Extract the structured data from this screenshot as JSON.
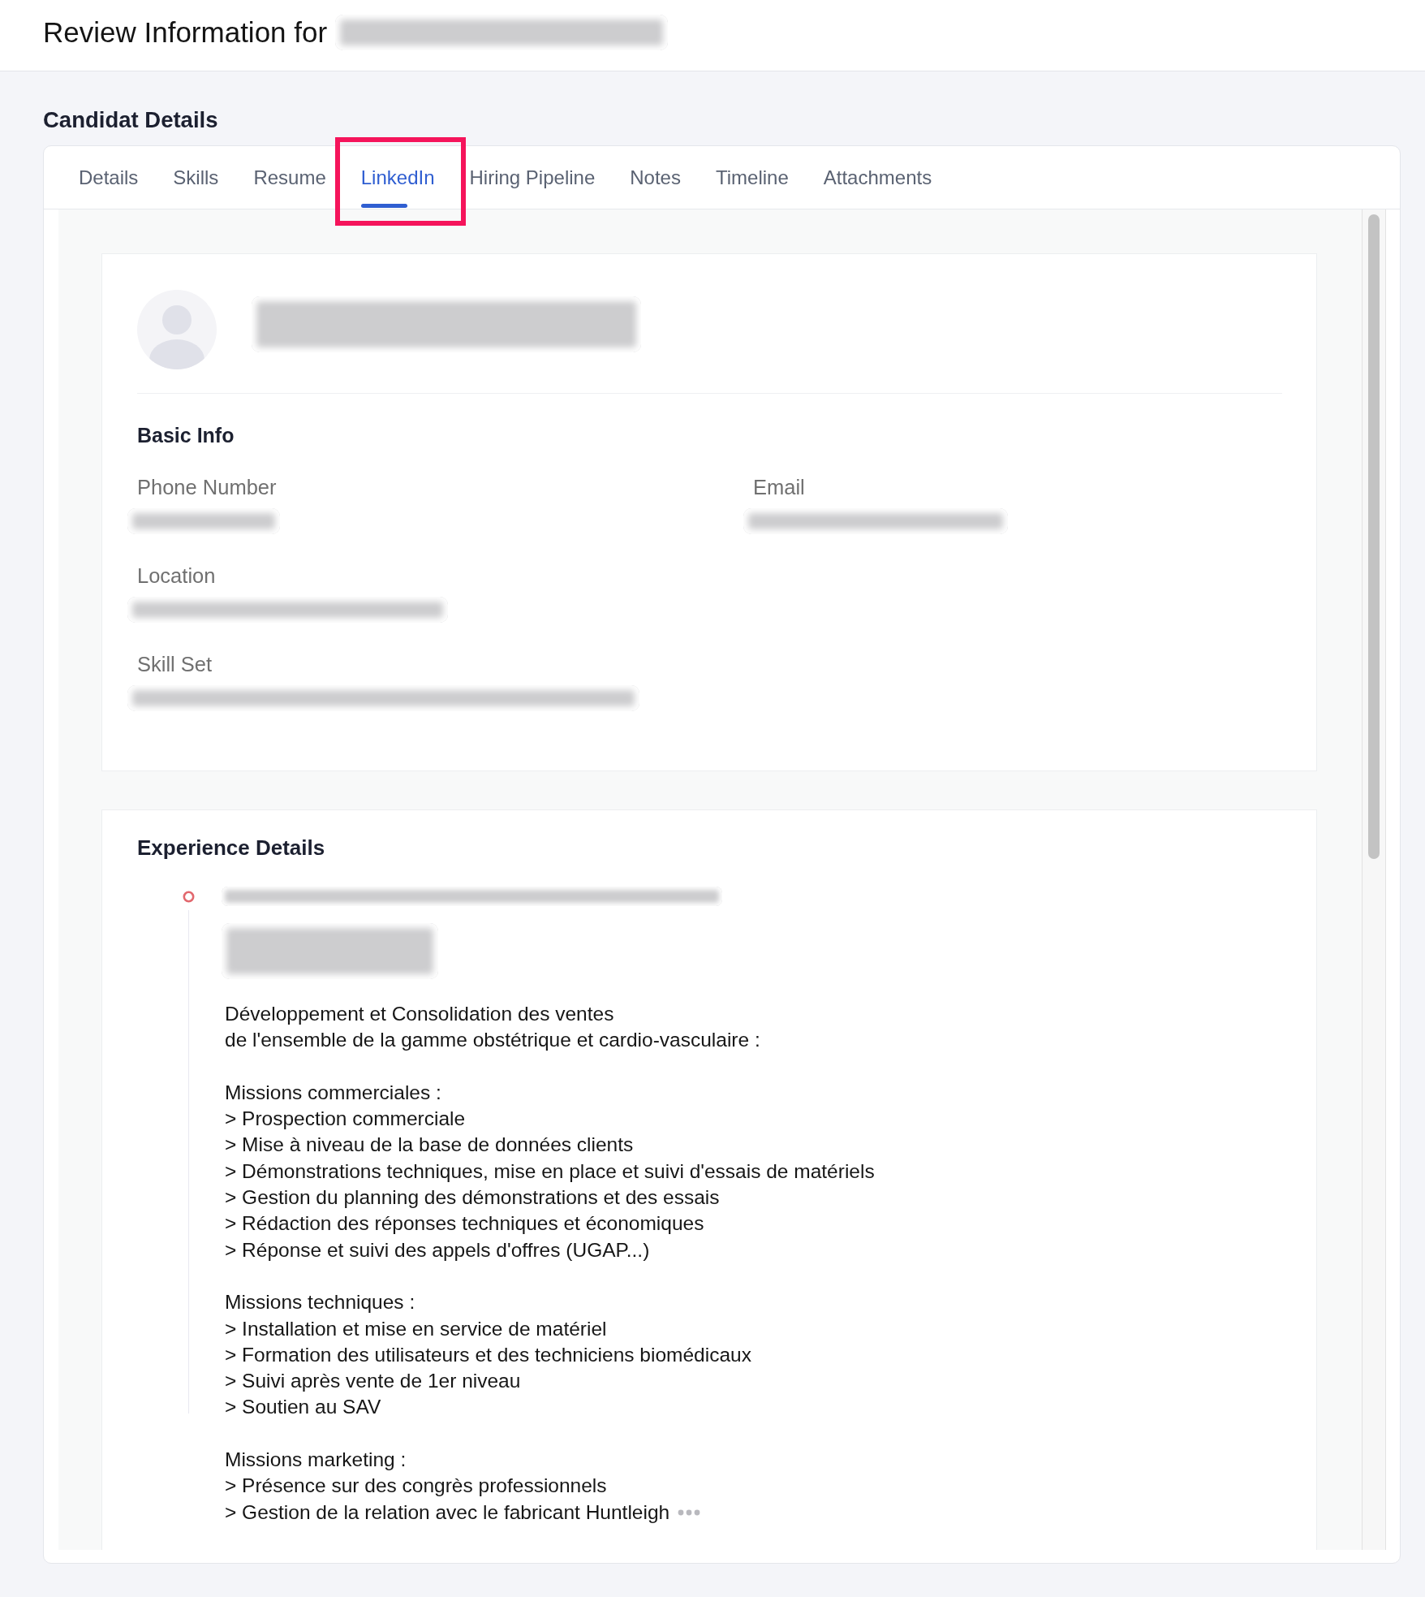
{
  "header": {
    "title": "Review Information for",
    "name_redacted": true
  },
  "page_title": "Candidat Details",
  "tabs": [
    {
      "label": "Details",
      "selected": false,
      "highlighted": false
    },
    {
      "label": "Skills",
      "selected": false,
      "highlighted": false
    },
    {
      "label": "Resume",
      "selected": false,
      "highlighted": false
    },
    {
      "label": "LinkedIn",
      "selected": true,
      "highlighted": true
    },
    {
      "label": "Hiring Pipeline",
      "selected": false,
      "highlighted": false
    },
    {
      "label": "Notes",
      "selected": false,
      "highlighted": false
    },
    {
      "label": "Timeline",
      "selected": false,
      "highlighted": false
    },
    {
      "label": "Attachments",
      "selected": false,
      "highlighted": false
    }
  ],
  "profile": {
    "name_redacted": true
  },
  "basic_info": {
    "title": "Basic Info",
    "fields": [
      {
        "label": "Phone Number",
        "redacted": true
      },
      {
        "label": "Email",
        "redacted": true
      },
      {
        "label": "Location",
        "redacted": true
      },
      {
        "label": "Skill Set",
        "redacted": true
      }
    ]
  },
  "experience": {
    "title": "Experience Details",
    "entries": [
      {
        "title_redacted": true,
        "company_redacted": true,
        "truncated": true,
        "description": [
          {
            "kind": "text",
            "lines": [
              "Développement et Consolidation des ventes",
              "de l'ensemble de la gamme obstétrique et cardio-vasculaire :"
            ]
          },
          {
            "kind": "list",
            "heading": "Missions commerciales :",
            "items": [
              "> Prospection commerciale",
              "> Mise à niveau de la base de données clients",
              "> Démonstrations techniques, mise en place et suivi d'essais de matériels",
              "> Gestion du planning des démonstrations et des essais",
              "> Rédaction des réponses techniques et économiques",
              "> Réponse et suivi des appels d'offres (UGAP...)"
            ]
          },
          {
            "kind": "list",
            "heading": "Missions techniques :",
            "items": [
              "> Installation et mise en service de matériel",
              "> Formation des utilisateurs et des techniciens biomédicaux",
              "> Suivi après vente de 1er niveau",
              "> Soutien au SAV"
            ]
          },
          {
            "kind": "list",
            "heading": "Missions marketing :",
            "items": [
              "> Présence sur des congrès professionnels",
              "> Gestion de la relation avec le fabricant Huntleigh"
            ]
          }
        ]
      }
    ]
  }
}
